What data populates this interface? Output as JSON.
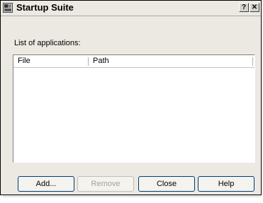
{
  "window": {
    "title": "Startup Suite",
    "help_button": "?",
    "close_button": "✕"
  },
  "list": {
    "label": "List of applications:",
    "columns": [
      "File",
      "Path"
    ],
    "rows": []
  },
  "buttons": {
    "add": "Add...",
    "remove": "Remove",
    "close": "Close",
    "help": "Help"
  },
  "states": {
    "remove_enabled": false
  }
}
